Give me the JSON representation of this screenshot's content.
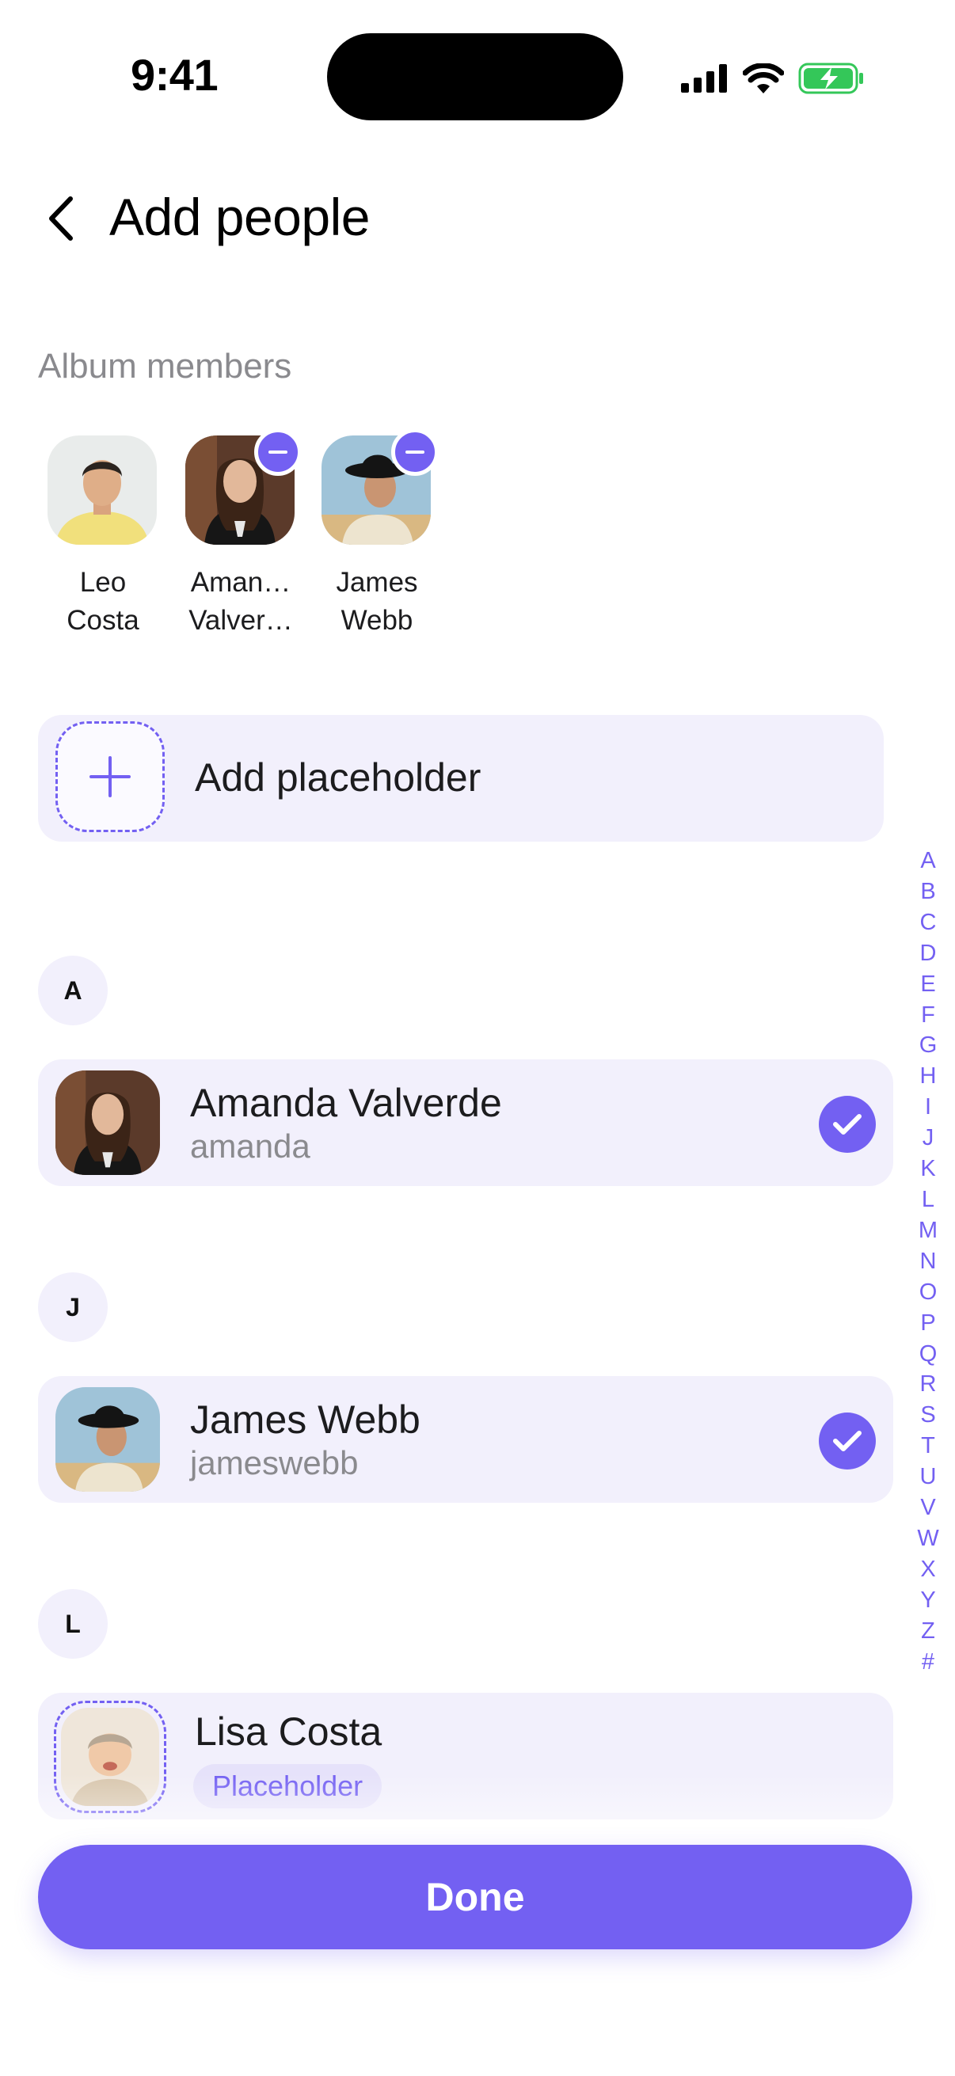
{
  "status_bar": {
    "time": "9:41"
  },
  "header": {
    "title": "Add people"
  },
  "album_members": {
    "label": "Album members",
    "members": [
      {
        "name": "Leo\nCosta"
      },
      {
        "name": "Aman…\nValver…"
      },
      {
        "name": "James\nWebb"
      }
    ]
  },
  "add_placeholder": {
    "label": "Add placeholder"
  },
  "sections": [
    {
      "letter": "A",
      "contacts": [
        {
          "name": "Amanda Valverde",
          "handle": "amanda",
          "selected": true
        }
      ]
    },
    {
      "letter": "J",
      "contacts": [
        {
          "name": "James Webb",
          "handle": "jameswebb",
          "selected": true
        }
      ]
    },
    {
      "letter": "L",
      "contacts": [
        {
          "name": "Lisa Costa",
          "tag": "Placeholder",
          "selected": false
        }
      ]
    }
  ],
  "alphabet_index": [
    "A",
    "B",
    "C",
    "D",
    "E",
    "F",
    "G",
    "H",
    "I",
    "J",
    "K",
    "L",
    "M",
    "N",
    "O",
    "P",
    "Q",
    "R",
    "S",
    "T",
    "U",
    "V",
    "W",
    "X",
    "Y",
    "Z",
    "#"
  ],
  "done_button": {
    "label": "Done"
  },
  "colors": {
    "accent": "#7360f2",
    "row_bg": "#f2f0fc",
    "muted_text": "#8a8a8e",
    "battery": "#34c759"
  }
}
